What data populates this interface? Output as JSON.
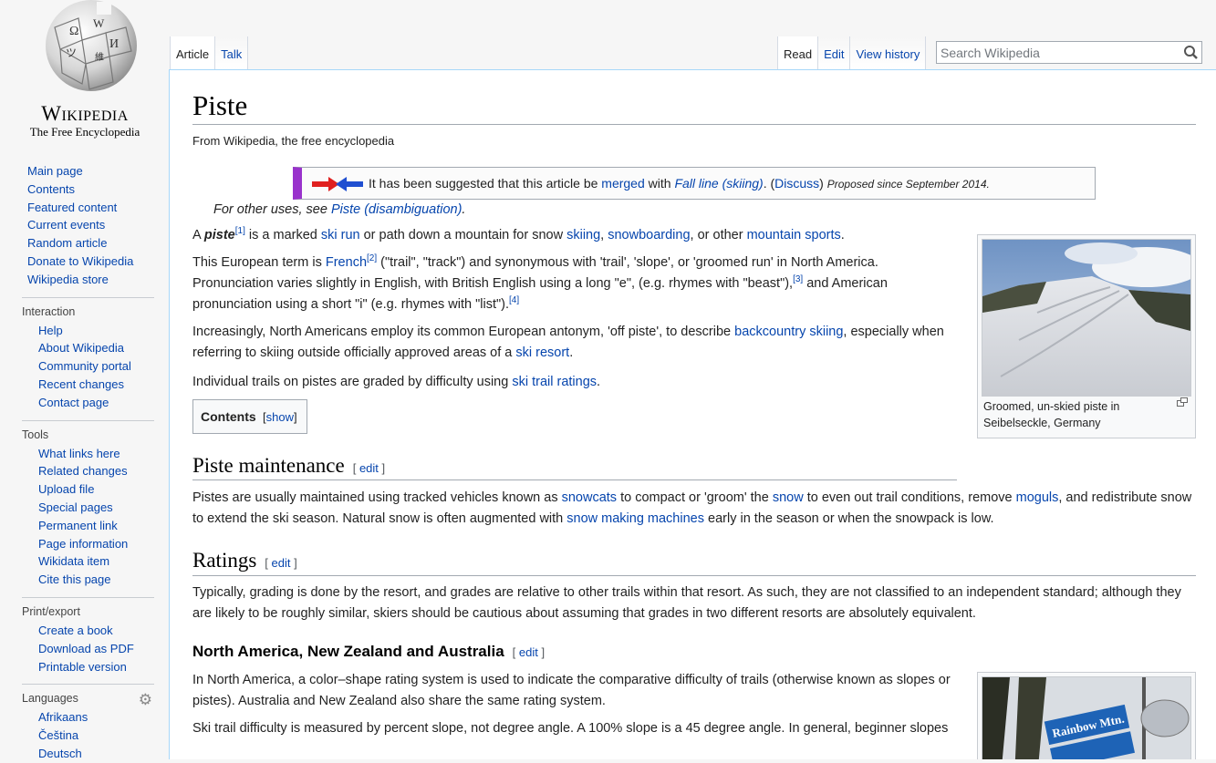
{
  "logo": {
    "wordmark": "Wikipedia",
    "tagline": "The Free Encyclopedia"
  },
  "main_nav": [
    "Main page",
    "Contents",
    "Featured content",
    "Current events",
    "Random article",
    "Donate to Wikipedia",
    "Wikipedia store"
  ],
  "portals": [
    {
      "heading": "Interaction",
      "items": [
        "Help",
        "About Wikipedia",
        "Community portal",
        "Recent changes",
        "Contact page"
      ]
    },
    {
      "heading": "Tools",
      "items": [
        "What links here",
        "Related changes",
        "Upload file",
        "Special pages",
        "Permanent link",
        "Page information",
        "Wikidata item",
        "Cite this page"
      ]
    },
    {
      "heading": "Print/export",
      "items": [
        "Create a book",
        "Download as PDF",
        "Printable version"
      ]
    },
    {
      "heading": "Languages",
      "items": [
        "Afrikaans",
        "Čeština",
        "Deutsch"
      ]
    }
  ],
  "tabs": {
    "article": "Article",
    "talk": "Talk",
    "read": "Read",
    "edit": "Edit",
    "history": "View history"
  },
  "search": {
    "placeholder": "Search Wikipedia"
  },
  "article": {
    "title": "Piste",
    "tagline": "From Wikipedia, the free encyclopedia",
    "merge": {
      "pre": "It has been suggested that this article be ",
      "merged": "merged",
      "with": " with ",
      "target": "Fall line (skiing)",
      "mid": ". (",
      "discuss": "Discuss",
      "close": ") ",
      "proposed": "Proposed since September 2014."
    },
    "hatnote": {
      "pre": "For other uses, see ",
      "link": "Piste (disambiguation)",
      "post": "."
    },
    "p1": {
      "a": "A ",
      "piste": "piste",
      "ref1": "[1]",
      "b": " is a marked ",
      "ski_run": "ski run",
      "c": " or path down a mountain for snow ",
      "skiing": "skiing",
      "d": ", ",
      "snowboarding": "snowboarding",
      "e": ", or other ",
      "mountain_sports": "mountain sports",
      "f": "."
    },
    "p2": {
      "a": "This European term is ",
      "french": "French",
      "ref2": "[2]",
      "b": " (\"trail\", \"track\") and synonymous with 'trail', 'slope', or 'groomed run' in North America. Pronunciation varies slightly in English, with British English using a long \"e\", (e.g. rhymes with \"beast\"),",
      "ref3": "[3]",
      "c": " and American pronunciation using a short \"i\" (e.g. rhymes with \"list\").",
      "ref4": "[4]"
    },
    "p3": {
      "a": "Increasingly, North Americans employ its common European antonym, 'off piste', to describe ",
      "backcountry": "backcountry skiing",
      "b": ", especially when referring to skiing outside officially approved areas of a ",
      "ski_resort": "ski resort",
      "c": "."
    },
    "p4": {
      "a": "Individual trails on pistes are graded by difficulty using ",
      "ratings": "ski trail ratings",
      "b": "."
    },
    "toc": {
      "title": "Contents",
      "show": "show"
    },
    "thumb1_caption": "Groomed, un-skied piste in Seibelseckle, Germany",
    "sec1": {
      "heading": "Piste maintenance",
      "edit": "edit"
    },
    "p5": {
      "a": "Pistes are usually maintained using tracked vehicles known as ",
      "snowcats": "snowcats",
      "b": " to compact or 'groom' the ",
      "snow": "snow",
      "c": " to even out trail conditions, remove ",
      "moguls": "moguls",
      "d": ", and redistribute snow to extend the ski season. Natural snow is often augmented with ",
      "snowmaking": "snow making machines",
      "e": " early in the season or when the snowpack is low."
    },
    "sec2": {
      "heading": "Ratings",
      "edit": "edit"
    },
    "p6": "Typically, grading is done by the resort, and grades are relative to other trails within that resort. As such, they are not classified to an independent standard; although they are likely to be roughly similar, skiers should be cautious about assuming that grades in two different resorts are absolutely equivalent.",
    "sec3": {
      "heading": "North America, New Zealand and Australia",
      "edit": "edit"
    },
    "p7": "In North America, a color–shape rating system is used to indicate the comparative difficulty of trails (otherwise known as slopes or pistes). Australia and New Zealand also share the same rating system.",
    "p8": "Ski trail difficulty is measured by percent slope, not degree angle. A 100% slope is a 45 degree angle. In general, beginner slopes",
    "thumb2_sign": "Rainbow Mtn."
  },
  "colors": {
    "link": "#0645ad",
    "merge_bar": "#9932cc"
  }
}
